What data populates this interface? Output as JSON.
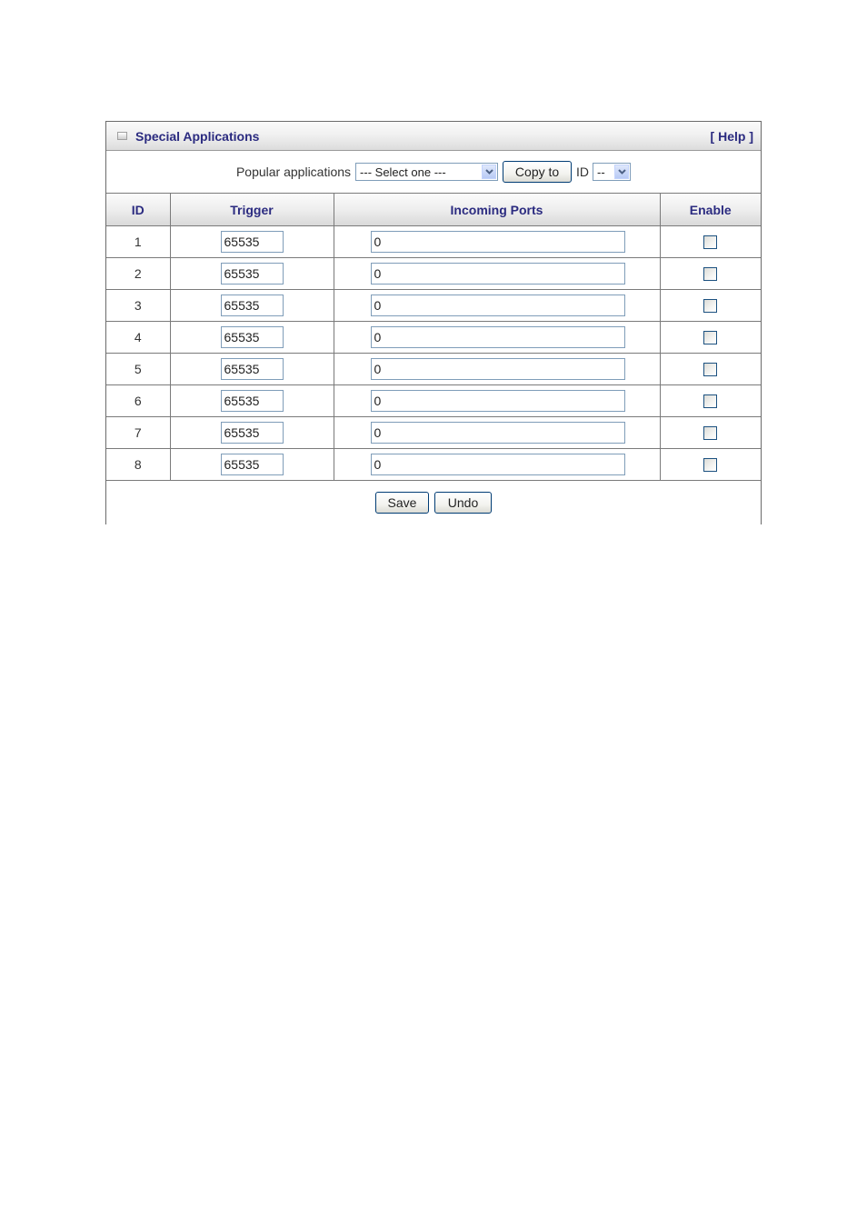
{
  "panel": {
    "title": "Special Applications",
    "title_icon": "square-bullet-icon",
    "help_label": "[ Help ]"
  },
  "popular": {
    "label": "Popular applications",
    "select_value": "--- Select one ---",
    "copy_button": "Copy to",
    "id_label": "ID",
    "id_select_value": "--"
  },
  "table": {
    "headers": [
      "ID",
      "Trigger",
      "Incoming Ports",
      "Enable"
    ],
    "rows": [
      {
        "id": "1",
        "trigger": "65535",
        "incoming": "0",
        "enabled": false
      },
      {
        "id": "2",
        "trigger": "65535",
        "incoming": "0",
        "enabled": false
      },
      {
        "id": "3",
        "trigger": "65535",
        "incoming": "0",
        "enabled": false
      },
      {
        "id": "4",
        "trigger": "65535",
        "incoming": "0",
        "enabled": false
      },
      {
        "id": "5",
        "trigger": "65535",
        "incoming": "0",
        "enabled": false
      },
      {
        "id": "6",
        "trigger": "65535",
        "incoming": "0",
        "enabled": false
      },
      {
        "id": "7",
        "trigger": "65535",
        "incoming": "0",
        "enabled": false
      },
      {
        "id": "8",
        "trigger": "65535",
        "incoming": "0",
        "enabled": false
      }
    ]
  },
  "footer": {
    "save_label": "Save",
    "undo_label": "Undo"
  },
  "colors": {
    "title_text": "#2b2b80",
    "border": "#7a7a7a",
    "input_border": "#7f9db9"
  }
}
